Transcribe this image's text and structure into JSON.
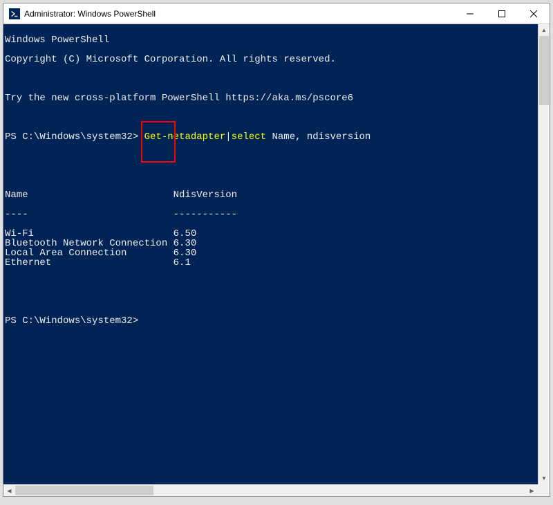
{
  "titlebar": {
    "title": "Administrator: Windows PowerShell"
  },
  "terminal": {
    "header_line1": "Windows PowerShell",
    "header_line2": "Copyright (C) Microsoft Corporation. All rights reserved.",
    "tip": "Try the new cross-platform PowerShell https://aka.ms/pscore6",
    "prompt1_prefix": "PS C:\\Windows\\system32> ",
    "cmd_part1": "Get-netadapter",
    "cmd_pipe": "|",
    "cmd_part2": "select ",
    "cmd_args": "Name, ndisversion",
    "col1_header": "Name",
    "col2_header": "NdisVersion",
    "col1_dashes": "----",
    "col2_dashes": "-----------",
    "rows": [
      {
        "name": "Wi-Fi",
        "ver": "6.50"
      },
      {
        "name": "Bluetooth Network Connection",
        "ver": "6.30"
      },
      {
        "name": "Local Area Connection",
        "ver": "6.30"
      },
      {
        "name": "Ethernet",
        "ver": "6.1"
      }
    ],
    "prompt2": "PS C:\\Windows\\system32>"
  }
}
